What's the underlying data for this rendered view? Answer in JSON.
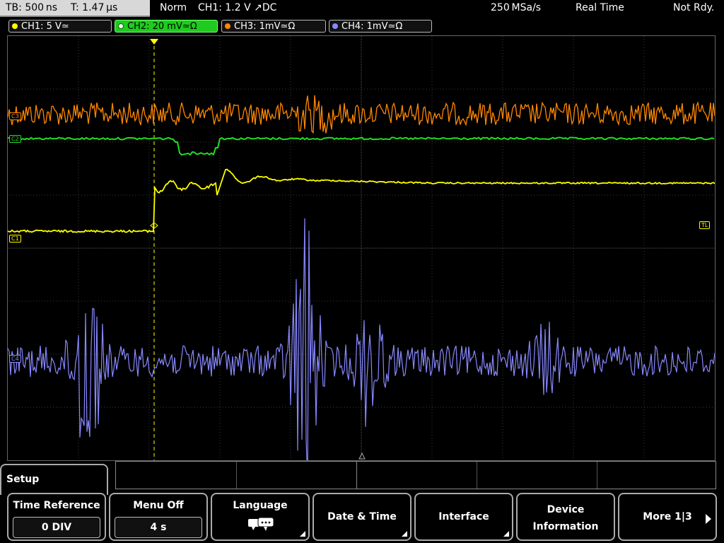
{
  "status": {
    "timebase": "TB: 500 ns",
    "trigger_time": "T: 1.47 µs",
    "mode": "Norm",
    "trigger_info": "CH1: 1.2 V ↗DC",
    "sample_rate": "250 MSa/s",
    "acq_mode": "Real Time",
    "status_text": "Not Rdy."
  },
  "channels": [
    {
      "label": "CH1: 5 V≃",
      "color": "#ffff00",
      "active": false
    },
    {
      "label": "CH2: 20 mV≃Ω",
      "color": "#22dd22",
      "active": true
    },
    {
      "label": "CH3: 1mV≃Ω",
      "color": "#ff8800",
      "active": false
    },
    {
      "label": "CH4: 1mV≃Ω",
      "color": "#8888ff",
      "active": false
    }
  ],
  "markers": {
    "trigger_label": "T",
    "trigger_level": "TL",
    "ch1_ref": "C1",
    "ch2_ref": "C2",
    "ch3_ref": "C3",
    "ch4_ref": "C4"
  },
  "menu": {
    "title": "Setup",
    "softkeys": [
      {
        "label": "Time Reference",
        "value": "0 DIV"
      },
      {
        "label": "Menu Off",
        "value": "4 s"
      },
      {
        "label": "Language",
        "icon": "speech-bubble-icon"
      },
      {
        "label": "Date & Time"
      },
      {
        "label": "Interface"
      },
      {
        "label": "Device",
        "label2": "Information"
      },
      {
        "label": "More 1|3"
      }
    ]
  },
  "colors": {
    "ch1": "#ffff00",
    "ch2": "#22dd22",
    "ch3": "#ff8800",
    "ch4": "#8888ff",
    "grid": "#444444",
    "trigger": "#ffff00"
  }
}
